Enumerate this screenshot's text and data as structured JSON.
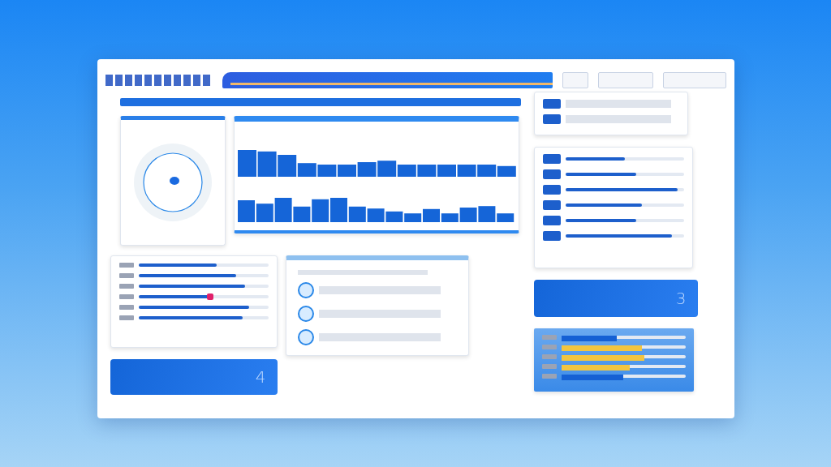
{
  "left_list": {
    "rows": [
      {
        "kind": "bar",
        "level": 0.6
      },
      {
        "kind": "bar",
        "level": 0.75
      },
      {
        "kind": "bar",
        "level": 0.82
      },
      {
        "kind": "slider",
        "level": 0.55
      },
      {
        "kind": "bar",
        "level": 0.85
      },
      {
        "kind": "bar",
        "level": 0.8
      }
    ]
  },
  "left_summary": {
    "value": "4"
  },
  "right_list": {
    "rows": [
      {
        "level": 0.5
      },
      {
        "level": 0.6
      },
      {
        "level": 0.95
      },
      {
        "level": 0.65
      },
      {
        "level": 0.6
      },
      {
        "level": 0.9
      }
    ]
  },
  "right_summary": {
    "value": "3"
  },
  "status_bars": {
    "rows": [
      {
        "level": 0.45,
        "color": "#1560d4"
      },
      {
        "level": 0.65,
        "color": "#f2c540"
      },
      {
        "level": 0.67,
        "color": "#f2c540"
      },
      {
        "level": 0.55,
        "color": "#f2c540"
      },
      {
        "level": 0.5,
        "color": "#1560d4"
      }
    ]
  }
}
